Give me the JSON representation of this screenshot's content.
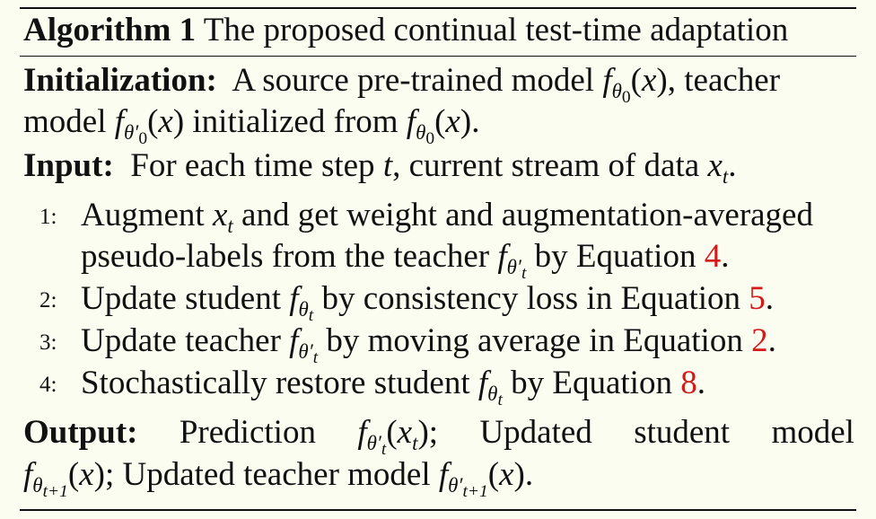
{
  "algorithm": {
    "label": "Algorithm 1",
    "title": "The proposed continual test-time adaptation"
  },
  "initialization": {
    "label": "Initialization:",
    "text_a": "A source pre-trained model",
    "text_b": ", teacher",
    "text_c": "model",
    "text_d": "initialized from",
    "text_e": "."
  },
  "input": {
    "label": "Input:",
    "text_a": "For each time step",
    "var_t": "t",
    "text_b": ", current stream of data",
    "text_c": "."
  },
  "steps": [
    {
      "number": "1:",
      "text_a": "Augment",
      "text_b": "and get weight and augmentation-averaged",
      "text_c": "pseudo-labels from the teacher",
      "text_d": "by Equation",
      "ref": "4",
      "text_e": "."
    },
    {
      "number": "2:",
      "text_a": "Update student",
      "text_b": "by consistency loss in Equation",
      "ref": "5",
      "text_c": "."
    },
    {
      "number": "3:",
      "text_a": "Update teacher",
      "text_b": "by moving average in Equation",
      "ref": "2",
      "text_c": "."
    },
    {
      "number": "4:",
      "text_a": "Stochastically restore student",
      "text_b": "by Equation",
      "ref": "8",
      "text_c": "."
    }
  ],
  "output": {
    "label": "Output:",
    "w1": "Prediction",
    "w2": ";",
    "w3": "Updated",
    "w4": "student",
    "w5": "model",
    "text_b": "; Updated teacher model",
    "text_c": "."
  },
  "colors": {
    "background": "#fbfdf0",
    "text": "#111111",
    "reference": "#d41a1a"
  }
}
